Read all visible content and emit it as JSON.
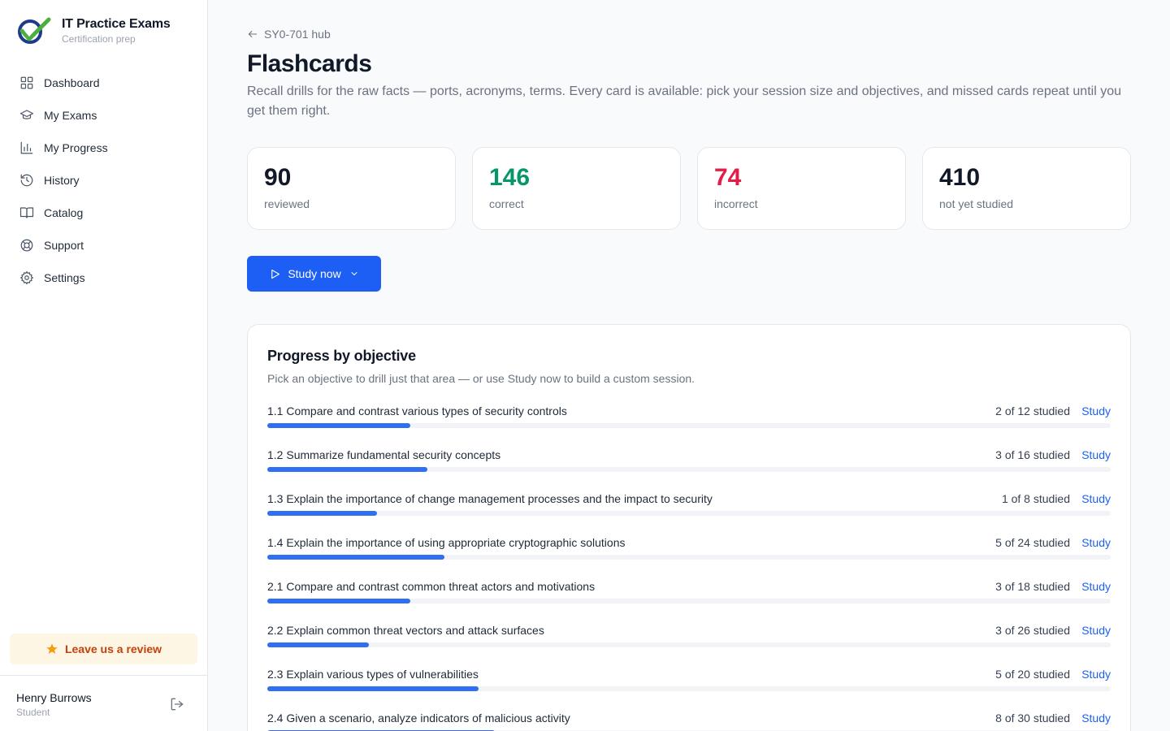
{
  "brand": {
    "title": "IT Practice Exams",
    "subtitle": "Certification prep"
  },
  "sidebar": {
    "items": [
      {
        "label": "Dashboard",
        "icon": "grid-icon"
      },
      {
        "label": "My Exams",
        "icon": "graduation-cap-icon"
      },
      {
        "label": "My Progress",
        "icon": "bar-chart-icon"
      },
      {
        "label": "History",
        "icon": "history-icon"
      },
      {
        "label": "Catalog",
        "icon": "book-icon"
      },
      {
        "label": "Support",
        "icon": "lifebuoy-icon"
      },
      {
        "label": "Settings",
        "icon": "gear-icon"
      }
    ],
    "review_label": "Leave us a review",
    "user": {
      "name": "Henry Burrows",
      "role": "Student"
    }
  },
  "header": {
    "back_label": "SY0-701 hub",
    "title": "Flashcards",
    "description": "Recall drills for the raw facts — ports, acronyms, terms. Every card is available: pick your session size and objectives, and missed cards repeat until you get them right."
  },
  "stats": [
    {
      "value": "90",
      "label": "reviewed",
      "color": "#111827"
    },
    {
      "value": "146",
      "label": "correct",
      "color": "#059669"
    },
    {
      "value": "74",
      "label": "incorrect",
      "color": "#e11d48"
    },
    {
      "value": "410",
      "label": "not yet studied",
      "color": "#111827"
    }
  ],
  "study_button": {
    "label": "Study now"
  },
  "objectives": {
    "title": "Progress by objective",
    "subtitle": "Pick an objective to drill just that area — or use Study now to build a custom session.",
    "study_label": "Study",
    "items": [
      {
        "label": "1.1 Compare and contrast various types of security controls",
        "count": "2 of 12 studied",
        "progress": 0.17
      },
      {
        "label": "1.2 Summarize fundamental security concepts",
        "count": "3 of 16 studied",
        "progress": 0.19
      },
      {
        "label": "1.3 Explain the importance of change management processes and the impact to security",
        "count": "1 of 8 studied",
        "progress": 0.13
      },
      {
        "label": "1.4 Explain the importance of using appropriate cryptographic solutions",
        "count": "5 of 24 studied",
        "progress": 0.21
      },
      {
        "label": "2.1 Compare and contrast common threat actors and motivations",
        "count": "3 of 18 studied",
        "progress": 0.17
      },
      {
        "label": "2.2 Explain common threat vectors and attack surfaces",
        "count": "3 of 26 studied",
        "progress": 0.12
      },
      {
        "label": "2.3 Explain various types of vulnerabilities",
        "count": "5 of 20 studied",
        "progress": 0.25
      },
      {
        "label": "2.4 Given a scenario, analyze indicators of malicious activity",
        "count": "8 of 30 studied",
        "progress": 0.27
      }
    ]
  }
}
